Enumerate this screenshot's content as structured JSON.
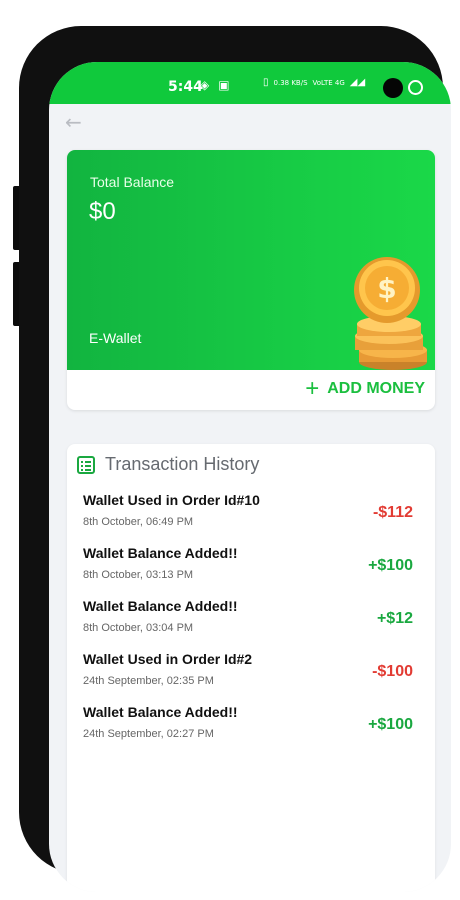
{
  "status_bar": {
    "time": "5:44",
    "data_speed": "0.38 KB/S",
    "network": "VoLTE 4G"
  },
  "icons": {
    "back": "arrow-left-icon",
    "history": "list-document-icon",
    "add": "plus-icon",
    "coins": "coin-stack-icon"
  },
  "wallet": {
    "total_label": "Total Balance",
    "total_value": "$0",
    "wallet_name": "E-Wallet",
    "add_money_label": "ADD MONEY"
  },
  "history": {
    "title": "Transaction History",
    "items": [
      {
        "title": "Wallet Used in Order Id#10",
        "date": "8th October, 06:49 PM",
        "amount": "-$112",
        "type": "debit"
      },
      {
        "title": "Wallet Balance Added!!",
        "date": "8th October, 03:13 PM",
        "amount": "+$100",
        "type": "credit"
      },
      {
        "title": "Wallet Balance Added!!",
        "date": "8th October, 03:04 PM",
        "amount": "+$12",
        "type": "credit"
      },
      {
        "title": "Wallet Used in Order Id#2",
        "date": "24th September, 02:35 PM",
        "amount": "-$100",
        "type": "debit"
      },
      {
        "title": "Wallet Balance Added!!",
        "date": "24th September, 02:27 PM",
        "amount": "+$100",
        "type": "credit"
      }
    ]
  },
  "colors": {
    "brand_green": "#17cb45",
    "credit": "#1aa840",
    "debit": "#e23b33"
  }
}
